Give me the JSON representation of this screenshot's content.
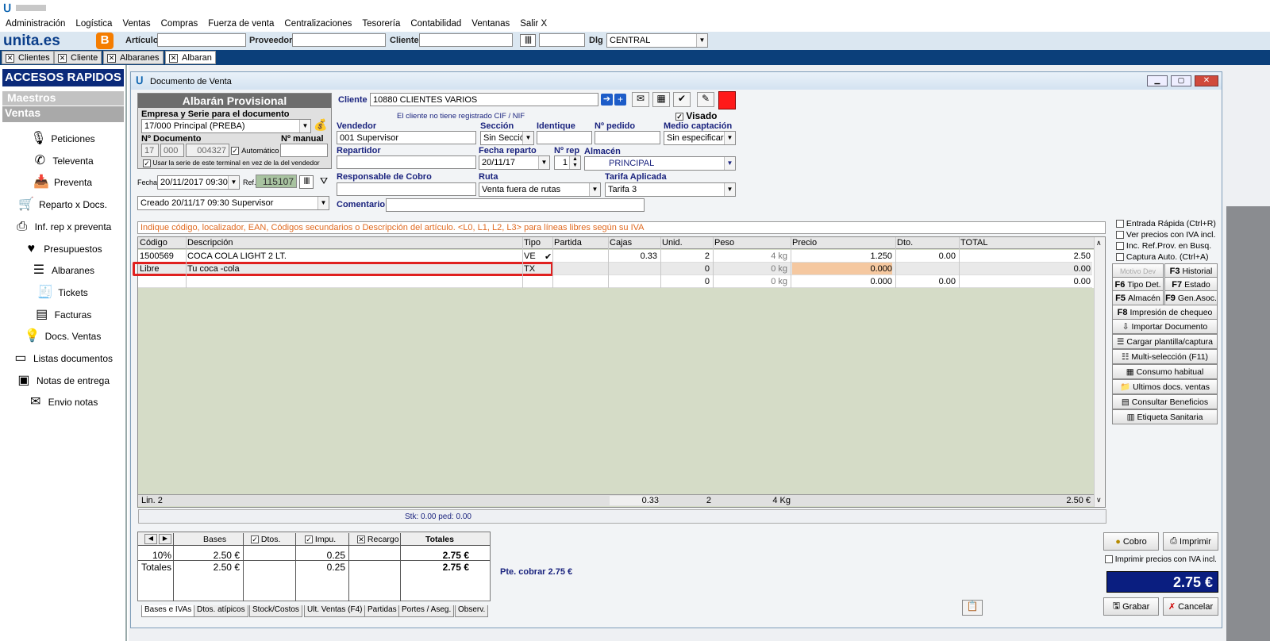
{
  "menu": [
    "Administración",
    "Logística",
    "Ventas",
    "Compras",
    "Fuerza de venta",
    "Centralizaciones",
    "Tesorería",
    "Contabilidad",
    "Ventanas",
    "Salir X"
  ],
  "toolbar": {
    "logo": "unita.es",
    "articulo_label": "Artículo",
    "proveedor_label": "Proveedor",
    "cliente_label": "Cliente",
    "dlg_label": "Dlg",
    "dlg_value": "CENTRAL"
  },
  "tabs": [
    "Clientes",
    "Cliente",
    "Albaranes",
    "Albaran"
  ],
  "sidebar": {
    "title": "ACCESOS RAPIDOS",
    "maestros": "Maestros",
    "ventas": "Ventas",
    "items": [
      {
        "label": "Peticiones",
        "icon": "microphone-icon"
      },
      {
        "label": "Televenta",
        "icon": "phone-icon"
      },
      {
        "label": "Preventa",
        "icon": "inbox-icon"
      },
      {
        "label": "Reparto x Docs.",
        "icon": "cart-icon"
      },
      {
        "label": "Inf. rep x preventa",
        "icon": "printer-icon"
      },
      {
        "label": "Presupuestos",
        "icon": "heart-icon"
      },
      {
        "label": "Albaranes",
        "icon": "list-icon"
      },
      {
        "label": "Tickets",
        "icon": "receipt-icon"
      },
      {
        "label": "Facturas",
        "icon": "invoice-icon"
      },
      {
        "label": "Docs. Ventas",
        "icon": "bulb-icon"
      },
      {
        "label": "Listas documentos",
        "icon": "tape-icon"
      },
      {
        "label": "Notas de entrega",
        "icon": "box-icon"
      },
      {
        "label": "Envio notas",
        "icon": "mail-icon"
      }
    ]
  },
  "window": {
    "title": "Documento de Venta"
  },
  "doc": {
    "header": "Albarán Provisional",
    "empresa_label": "Empresa y Serie para el documento",
    "empresa_value": "17/000 Principal (PREBA)",
    "ndoc_label": "Nº Documento",
    "nmanual_label": "Nº manual",
    "ndoc_year": "17",
    "ndoc_serie": "000",
    "ndoc_num": "004327",
    "automatico": "Automático",
    "usar_serie": "Usar la serie de este terminal en vez de la del vendedor",
    "fecha_label": "Fecha",
    "fecha_value": "20/11/2017 09:30",
    "ref_label": "Ref.",
    "ref_value": "115107",
    "creado": "Creado 20/11/17 09:30 Supervisor"
  },
  "form": {
    "cliente_label": "Cliente",
    "cliente_value": "10880 CLIENTES VARIOS",
    "cif_msg": "El cliente no tiene registrado CIF / NIF",
    "visado": "Visado",
    "vendedor_label": "Vendedor",
    "vendedor_value": "001 Supervisor",
    "seccion_label": "Sección",
    "seccion_value": "Sin Secciói",
    "identique_label": "Identique",
    "npedido_label": "Nº pedido",
    "medio_label": "Medio captación",
    "medio_value": "Sin especificar",
    "repartidor_label": "Repartidor",
    "fecha_reparto_label": "Fecha reparto",
    "fecha_reparto_value": "20/11/17",
    "nrep_label": "Nº rep",
    "nrep_value": "1",
    "almacen_label": "Almacén",
    "almacen_value": "PRINCIPAL",
    "responsable_label": "Responsable de Cobro",
    "ruta_label": "Ruta",
    "ruta_value": "Venta fuera de rutas",
    "tarifa_label": "Tarifa Aplicada",
    "tarifa_value": "Tarifa 3",
    "comentario_label": "Comentario"
  },
  "hint": "Indique código, localizador, EAN, Códigos secundarios o Descripción del artículo.  <L0, L1, L2, L3> para líneas libres según su IVA",
  "grid": {
    "columns": [
      "Código",
      "Descripción",
      "Tipo",
      "Partida",
      "Cajas",
      "Unid.",
      "Peso",
      "Precio",
      "Dto.",
      "TOTAL"
    ],
    "rows": [
      {
        "codigo": "1500569",
        "desc": "COCA COLA LIGHT 2 LT.",
        "tipo": "VE",
        "partida": "",
        "cajas": "0.33",
        "unid": "2",
        "peso": "4 kg",
        "precio": "1.250",
        "dto": "0.00",
        "total": "2.50"
      },
      {
        "codigo": "Libre",
        "desc": "Tu coca -cola",
        "tipo": "TX",
        "partida": "",
        "cajas": "",
        "unid": "0",
        "peso": "0 kg",
        "precio": "0.000",
        "dto": "",
        "total": "0.00"
      },
      {
        "codigo": "",
        "desc": "",
        "tipo": "",
        "partida": "",
        "cajas": "",
        "unid": "0",
        "peso": "0 kg",
        "precio": "0.000",
        "dto": "0.00",
        "total": "0.00"
      }
    ],
    "footer": {
      "lin": "Lin. 2",
      "cajas": "0.33",
      "unid": "2",
      "peso": "4 Kg",
      "total": "2.50 €"
    },
    "stk": "Stk: 0.00 ped: 0.00"
  },
  "right_panel": {
    "checks": [
      "Entrada Rápida (Ctrl+R)",
      "Ver precios con IVA incl.",
      "Inc. Ref.Prov. en Busq.",
      "Captura Auto. (Ctrl+A)"
    ],
    "motivo_dev": "Motivo Dev",
    "f3": "Historial",
    "f6": "Tipo Det.",
    "f7": "Estado",
    "f5": "Almacén",
    "f9": "Gen.Asoc.",
    "f8": "Impresión de chequeo",
    "buttons": [
      "Importar Documento",
      "Cargar plantilla/captura",
      "Multi-selección (F11)",
      "Consumo habitual",
      "Ultimos docs. ventas",
      "Consultar Beneficios",
      "Etiqueta Sanitaria"
    ]
  },
  "totals": {
    "bases": "Bases",
    "dtos": "Dtos.",
    "impu": "Impu.",
    "recargo": "Recargo",
    "totales": "Totales",
    "row1": {
      "label": "10%",
      "bases": "2.50 €",
      "impu": "0.25",
      "total": "2.75 €"
    },
    "row2": {
      "label": "Totales",
      "bases": "2.50 €",
      "impu": "0.25",
      "total": "2.75 €"
    }
  },
  "bottom_tabs": [
    "Bases e IVAs",
    "Dtos. atípicos",
    "Stock/Costos",
    "Ult. Ventas (F4)",
    "Partidas",
    "Portes / Aseg.",
    "Observ."
  ],
  "pte_cobrar": "Pte. cobrar 2.75 €",
  "actions": {
    "cobro": "Cobro",
    "imprimir": "Imprimir",
    "imprimir_iva": "Imprimir precios con IVA incl.",
    "grabar": "Grabar",
    "cancelar": "Cancelar"
  },
  "total_display": "2.75 €",
  "colors": {
    "accent": "#0b3f7a",
    "highlight": "#e0201f",
    "grid_bg": "#d5dcc7"
  }
}
